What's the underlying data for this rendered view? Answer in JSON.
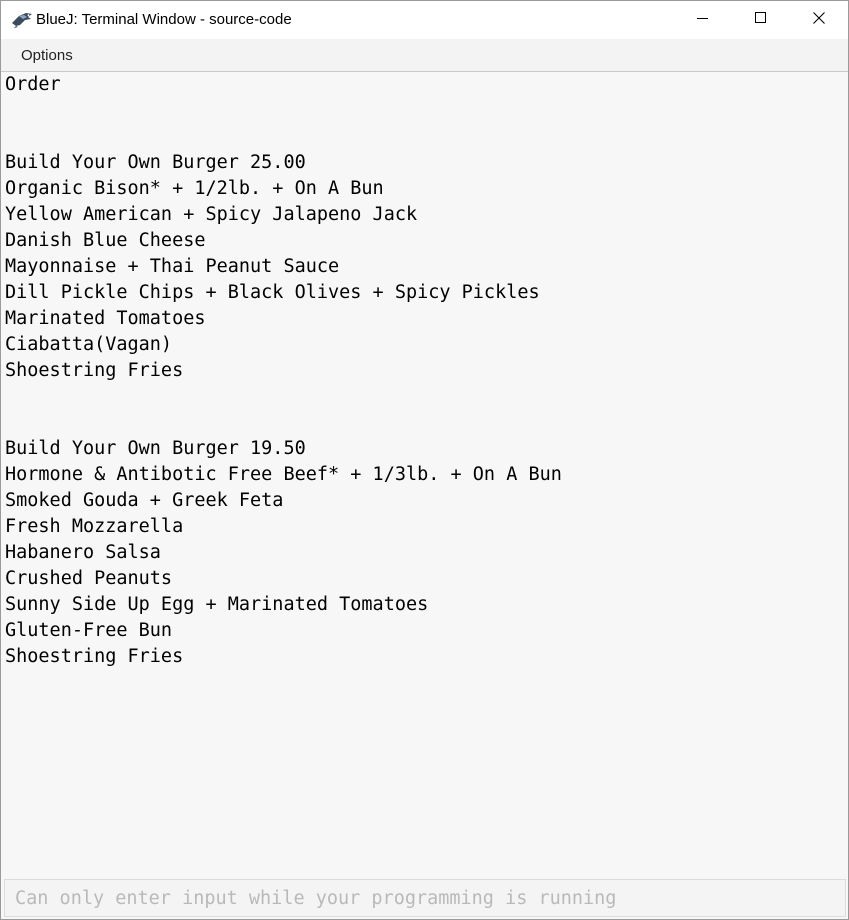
{
  "window": {
    "title": "BlueJ: Terminal Window - source-code"
  },
  "menu": {
    "items": [
      "Options"
    ]
  },
  "terminal": {
    "lines": [
      "Order",
      "",
      "",
      "Build Your Own Burger 25.00",
      "Organic Bison* + 1/2lb. + On A Bun",
      "Yellow American + Spicy Jalapeno Jack",
      "Danish Blue Cheese",
      "Mayonnaise + Thai Peanut Sauce",
      "Dill Pickle Chips + Black Olives + Spicy Pickles",
      "Marinated Tomatoes",
      "Ciabatta(Vagan)",
      "Shoestring Fries",
      "",
      "",
      "Build Your Own Burger 19.50",
      "Hormone & Antibotic Free Beef* + 1/3lb. + On A Bun",
      "Smoked Gouda + Greek Feta",
      "Fresh Mozzarella",
      "Habanero Salsa",
      "Crushed Peanuts",
      "Sunny Side Up Egg + Marinated Tomatoes",
      "Gluten-Free Bun",
      "Shoestring Fries"
    ]
  },
  "input": {
    "placeholder": "Can only enter input while your programming is running",
    "value": ""
  },
  "icons": {
    "app": "bluej-bird-icon",
    "minimize": "minimize-icon",
    "maximize": "maximize-icon",
    "close": "close-icon"
  }
}
